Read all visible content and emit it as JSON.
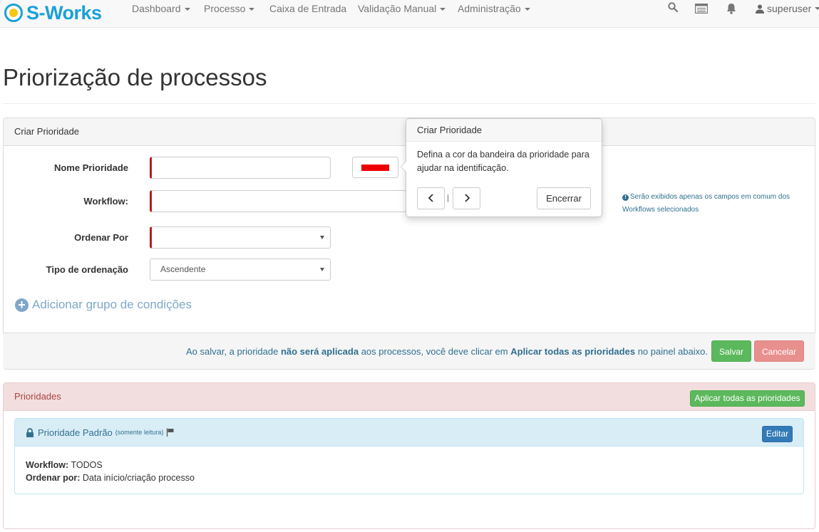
{
  "nav": {
    "brand": "S-Works",
    "items": [
      "Dashboard",
      "Processo",
      "Caixa de Entrada",
      "Validação Manual",
      "Administração"
    ],
    "user": "superuser"
  },
  "page": {
    "title": "Priorização de processos"
  },
  "create_panel": {
    "heading": "Criar Prioridade",
    "labels": {
      "name": "Nome Prioridade",
      "workflow": "Workflow:",
      "order_by": "Ordenar Por",
      "order_type": "Tipo de ordenação"
    },
    "order_type_value": "Ascendente",
    "flag_color": "#ee0000",
    "info_note": "Serão exibidos apenas os campos em comum dos Workflows selecionados",
    "add_group": "Adicionar grupo de condições",
    "footer": {
      "t1": "Ao salvar, a prioridade ",
      "b1": "não será aplicada",
      "t2": " aos processos, você deve clicar em ",
      "b2": "Aplicar todas as prioridades",
      "t3": " no painel abaixo."
    },
    "save": "Salvar",
    "cancel": "Cancelar"
  },
  "popover": {
    "title": "Criar Prioridade",
    "content": "Defina a cor da bandeira da prioridade para ajudar na identificação.",
    "close": "Encerrar"
  },
  "priorities_panel": {
    "heading": "Prioridades",
    "apply_all": "Aplicar todas as prioridades",
    "default_priority": {
      "title": "Prioridade Padrão",
      "readonly": "(somente leitura)",
      "edit": "Editar",
      "workflow_label": "Workflow:",
      "workflow_value": "TODOS",
      "order_label": "Ordenar por:",
      "order_value": "Data início/criação processo"
    }
  }
}
